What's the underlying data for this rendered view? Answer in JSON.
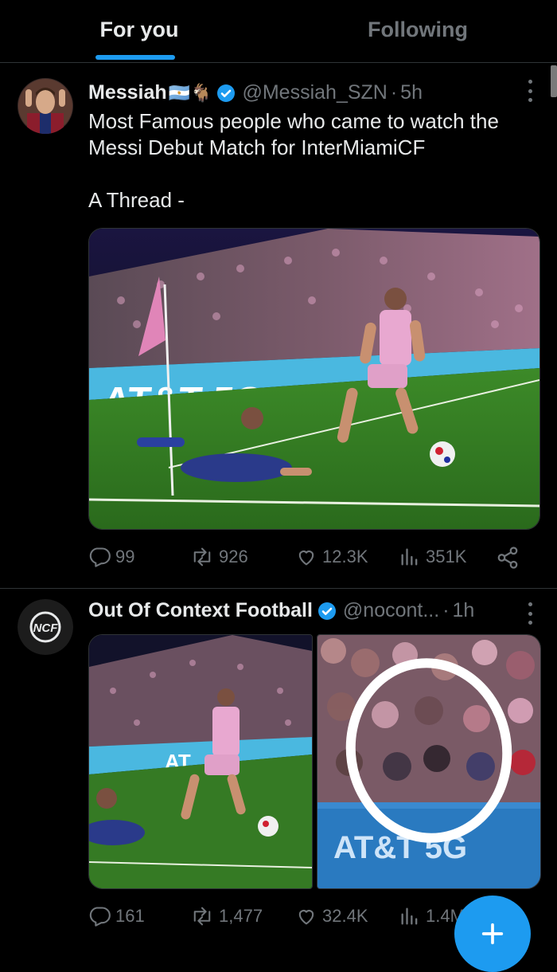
{
  "tabs": [
    {
      "label": "For you",
      "active": true
    },
    {
      "label": "Following",
      "active": false
    }
  ],
  "tweets": [
    {
      "author_name": "Messiah",
      "author_flags": "🇦🇷🐐",
      "handle": "@Messiah_SZN",
      "time": "5h",
      "verified": true,
      "text_lines": [
        "Most Famous people who came to watch the",
        "Messi Debut Match for InterMiamiCF",
        "",
        "A Thread -"
      ],
      "media": {
        "type": "single-photo",
        "sign_text": "AT&T 5G"
      },
      "stats": {
        "replies": "99",
        "reposts": "926",
        "likes": "12.3K",
        "views": "351K"
      }
    },
    {
      "author_name": "Out Of Context Football",
      "avatar_text": "NCF",
      "handle": "@nocont...",
      "time": "1h",
      "verified": true,
      "media": {
        "type": "two-photos",
        "sign_text_left": "AT",
        "sign_text_right": "AT&T 5G"
      },
      "stats": {
        "replies": "161",
        "reposts": "1,477",
        "likes": "32.4K",
        "views": "1.4M"
      }
    }
  ],
  "colors": {
    "accent": "#1d9bf0",
    "background": "#000000",
    "muted": "#71767b",
    "text": "#e7e9ea"
  },
  "icons": [
    "reply-icon",
    "repost-icon",
    "like-icon",
    "views-icon",
    "share-icon",
    "verified-icon",
    "more-icon",
    "plus-icon"
  ]
}
